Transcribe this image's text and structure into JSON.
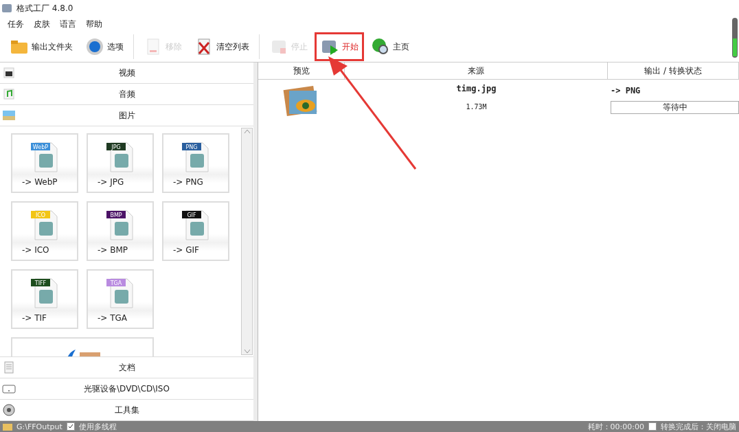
{
  "window": {
    "title": "格式工厂 4.8.0"
  },
  "menu": [
    "任务",
    "皮肤",
    "语言",
    "帮助"
  ],
  "toolbar": [
    {
      "kind": "folder",
      "label": "输出文件夹",
      "disabled": false,
      "highlighted": false
    },
    {
      "kind": "gear",
      "label": "选项",
      "disabled": false,
      "highlighted": false
    },
    {
      "kind": "remove",
      "label": "移除",
      "disabled": true,
      "highlighted": false
    },
    {
      "kind": "clear",
      "label": "清空列表",
      "disabled": false,
      "highlighted": false
    },
    {
      "kind": "stop",
      "label": "停止",
      "disabled": true,
      "highlighted": false
    },
    {
      "kind": "start",
      "label": "开始",
      "disabled": false,
      "highlighted": true
    },
    {
      "kind": "home",
      "label": "主页",
      "disabled": false,
      "highlighted": false
    }
  ],
  "categories_top": [
    {
      "kind": "video",
      "label": "视频"
    },
    {
      "kind": "audio",
      "label": "音频"
    },
    {
      "kind": "picture",
      "label": "图片"
    }
  ],
  "tiles": [
    {
      "tag": "WebP",
      "label": "-> WebP",
      "color": "#3b8fd9"
    },
    {
      "tag": "JPG",
      "label": "-> JPG",
      "color": "#1f3a22"
    },
    {
      "tag": "PNG",
      "label": "-> PNG",
      "color": "#2a5f9e"
    },
    {
      "tag": "ICO",
      "label": "-> ICO",
      "color": "#f2c515"
    },
    {
      "tag": "BMP",
      "label": "-> BMP",
      "color": "#4b1266"
    },
    {
      "tag": "GIF",
      "label": "-> GIF",
      "color": "#111111"
    },
    {
      "tag": "TIFF",
      "label": "-> TIF",
      "color": "#1d4d1d"
    },
    {
      "tag": "TGA",
      "label": "-> TGA",
      "color": "#b98be0"
    }
  ],
  "categories_bottom": [
    {
      "kind": "document",
      "label": "文档"
    },
    {
      "kind": "disc",
      "label": "光驱设备\\DVD\\CD\\ISO"
    },
    {
      "kind": "tools",
      "label": "工具集"
    }
  ],
  "table": {
    "columns": [
      "预览",
      "来源",
      "输出 / 转换状态"
    ],
    "rows": [
      {
        "name": "timg.jpg",
        "size": "1.73M",
        "output": "-> PNG",
        "status": "等待中"
      }
    ]
  },
  "status_bar": {
    "folder": "G:\\FFOutput",
    "multithread": {
      "label": "使用多线程",
      "checked": true
    },
    "elapsed": "耗时：00:00:00",
    "shutdown": {
      "label": "转换完成后：关闭电脑",
      "checked": false
    }
  }
}
